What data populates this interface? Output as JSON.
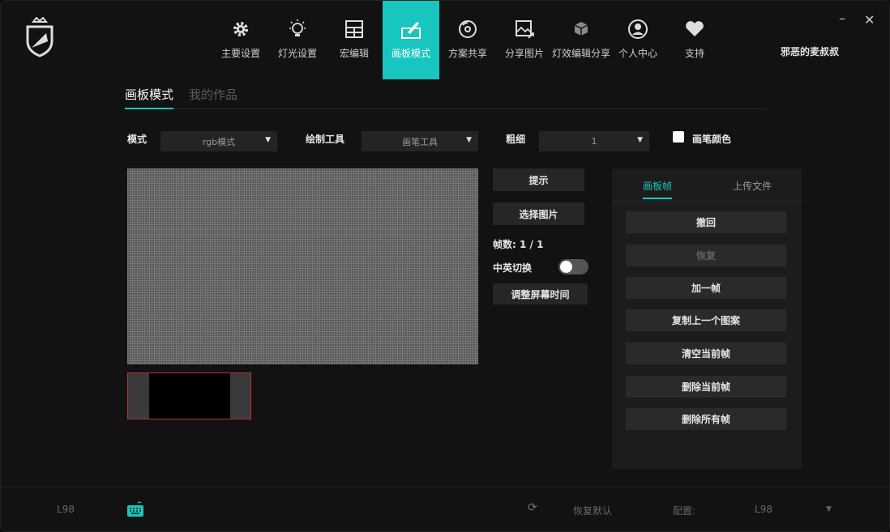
{
  "nav": [
    {
      "label": "主要设置",
      "icon": "gear-icon"
    },
    {
      "label": "灯光设置",
      "icon": "bulb-icon"
    },
    {
      "label": "宏编辑",
      "icon": "grid-icon"
    },
    {
      "label": "画板模式",
      "icon": "paint-icon"
    },
    {
      "label": "方案共享",
      "icon": "disc-icon"
    },
    {
      "label": "分享图片",
      "icon": "image-share-icon"
    },
    {
      "label": "灯效编辑分享",
      "icon": "cube-icon"
    },
    {
      "label": "个人中心",
      "icon": "user-icon"
    },
    {
      "label": "支持",
      "icon": "heart-icon"
    }
  ],
  "active_nav_index": 3,
  "user": {
    "name": "邪恶的麦叔叔"
  },
  "tabs": {
    "active": "画板模式",
    "inactive": "我的作品"
  },
  "controls": {
    "mode_label": "模式",
    "mode_value": "rgb模式",
    "tool_label": "绘制工具",
    "tool_value": "画笔工具",
    "size_label": "粗细",
    "size_value": "1",
    "color_label": "画笔颜色"
  },
  "actions": {
    "hint": "提示",
    "select_image": "选择图片",
    "frames": "帧数: 1 / 1",
    "lang_toggle": "中英切换",
    "adjust_time": "调整屏幕时间"
  },
  "panel": {
    "tab_frames": "画板帧",
    "tab_upload": "上传文件",
    "buttons": [
      "撤回",
      "恢复",
      "加一帧",
      "复制上一个图案",
      "清空当前帧",
      "删除当前帧",
      "删除所有帧"
    ]
  },
  "footer": {
    "device": "L98",
    "restore": "恢复默认",
    "config_label": "配置:",
    "config_value": "L98"
  },
  "colors": {
    "accent": "#17c6bf",
    "thumb_border": "#c0302b"
  }
}
